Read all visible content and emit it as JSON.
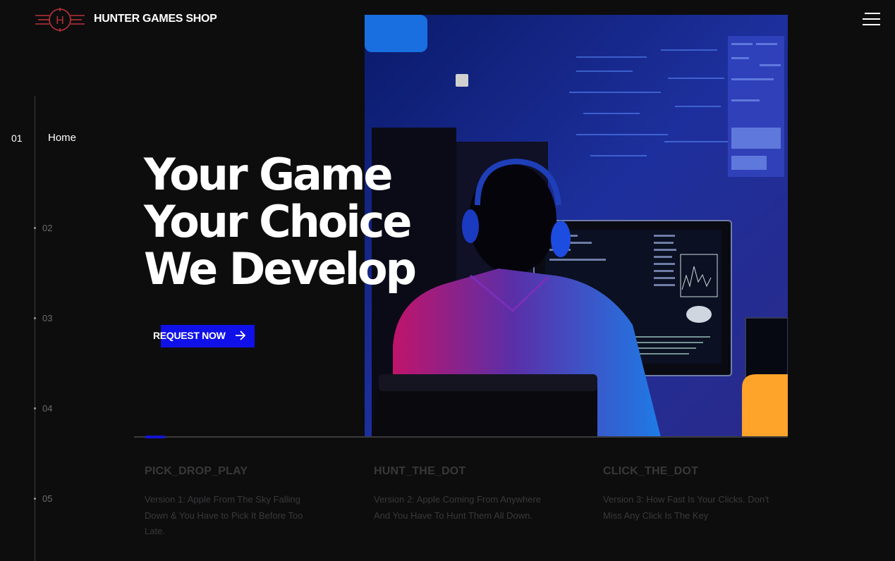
{
  "header": {
    "logo_letter": "H",
    "brand": "HUNTER GAMES SHOP"
  },
  "nav": {
    "items": [
      {
        "number": "01",
        "label": "Home"
      },
      {
        "number": "02",
        "label": ""
      },
      {
        "number": "03",
        "label": ""
      },
      {
        "number": "04",
        "label": ""
      },
      {
        "number": "05",
        "label": ""
      }
    ],
    "active_index": 0
  },
  "hero": {
    "headline_lines": [
      "Your Game",
      "Your Choice",
      "We Develop"
    ],
    "cta_label": "REQUEST NOW",
    "slide_progress": 0.03
  },
  "games": [
    {
      "title": "PICK_DROP_PLAY",
      "description": "Version 1: Apple From The Sky Falling Down & You Have to Pick It Before Too Late."
    },
    {
      "title": "HUNT_THE_DOT",
      "description": "Version 2: Apple Coming From Anywhere And You Have To Hunt Them All Down."
    },
    {
      "title": "CLICK_THE_DOT",
      "description": "Version 3: How Fast Is Your Clicks. Don't Miss Any Click Is The Key"
    }
  ],
  "colors": {
    "background": "#0d0d0e",
    "accent_blue": "#1010e8",
    "logo_red": "#b8323a",
    "accent_orange": "#ffa42a"
  },
  "icons": {
    "logo": "crosshair-h-logo",
    "menu": "hamburger-icon",
    "cta": "arrow-right-icon"
  }
}
